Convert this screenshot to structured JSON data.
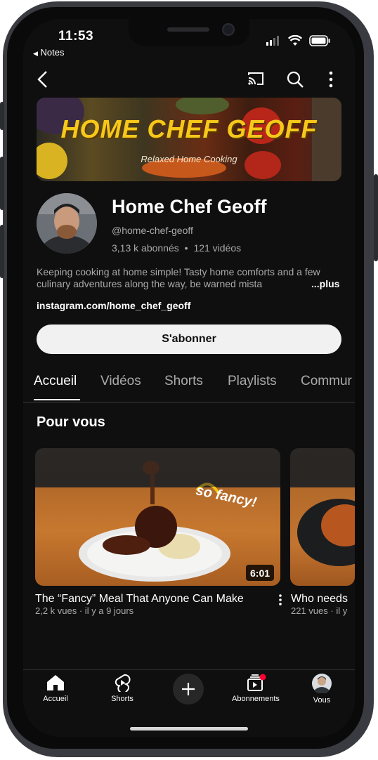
{
  "status_bar": {
    "time": "11:53",
    "back_app": "Notes"
  },
  "header_icons": [
    "back-arrow-icon",
    "cast-icon",
    "search-icon",
    "more-vert-icon"
  ],
  "banner": {
    "title": "HOME CHEF GEOFF",
    "subtitle": "Relaxed Home Cooking"
  },
  "channel": {
    "name": "Home Chef Geoff",
    "handle": "@home-chef-geoff",
    "subscribers": "3,13 k abonnés",
    "separator": "•",
    "videos": "121 vidéos",
    "description": "Keeping cooking at home simple! Tasty home comforts and a few culinary adventures along the way, be warned mista",
    "more": "...plus",
    "link": "instagram.com/home_chef_geoff",
    "subscribe_label": "S'abonner"
  },
  "tabs": [
    {
      "label": "Accueil",
      "active": true
    },
    {
      "label": "Vidéos",
      "active": false
    },
    {
      "label": "Shorts",
      "active": false
    },
    {
      "label": "Playlists",
      "active": false
    },
    {
      "label": "Commur",
      "active": false
    }
  ],
  "section": {
    "title": "Pour vous"
  },
  "videos": [
    {
      "title": "The “Fancy” Meal That Anyone Can Make",
      "meta": "2,2 k vues · il y a 9 jours",
      "duration": "6:01",
      "overlay_text": "so fancy!"
    },
    {
      "title": "Who needs",
      "meta": "221 vues · il y"
    }
  ],
  "bottom_nav": [
    {
      "label": "Accueil",
      "icon": "home-icon"
    },
    {
      "label": "Shorts",
      "icon": "shorts-icon"
    },
    {
      "label": "",
      "icon": "create-plus-icon"
    },
    {
      "label": "Abonnements",
      "icon": "subscriptions-icon"
    },
    {
      "label": "Vous",
      "icon": "avatar-icon"
    }
  ],
  "colors": {
    "background": "#0f0f0f",
    "text_secondary": "#aaaaaa",
    "button_bg": "#f1f1f1",
    "notification_dot": "#ff0033",
    "banner_title": "#f6c81a"
  }
}
